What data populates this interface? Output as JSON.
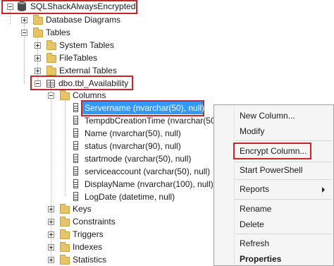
{
  "tree": {
    "database": "SQLShackAlwaysEncrypted",
    "database_diagrams": "Database Diagrams",
    "tables": "Tables",
    "system_tables": "System Tables",
    "file_tables": "FileTables",
    "external_tables": "External Tables",
    "table": "dbo.tbl_Availability",
    "columns_folder": "Columns",
    "columns": [
      "Servername (nvarchar(50), null)",
      "TempdbCreationTime (nvarchar(50",
      "Name (nvarchar(50), null)",
      "status (nvarchar(90), null)",
      "startmode (varchar(50), null)",
      "serviceaccount (varchar(50), null)",
      "DisplayName (nvarchar(100), null)",
      "LogDate (datetime, null)"
    ],
    "subfolders": [
      "Keys",
      "Constraints",
      "Triggers",
      "Indexes",
      "Statistics"
    ]
  },
  "context_menu": {
    "items": [
      "New Column...",
      "Modify",
      "Encrypt Column...",
      "Start PowerShell",
      "Reports",
      "Rename",
      "Delete",
      "Refresh",
      "Properties"
    ]
  },
  "colors": {
    "highlight_box": "#c0282b",
    "selection": "#3399ff",
    "folder": "#e8c468"
  }
}
